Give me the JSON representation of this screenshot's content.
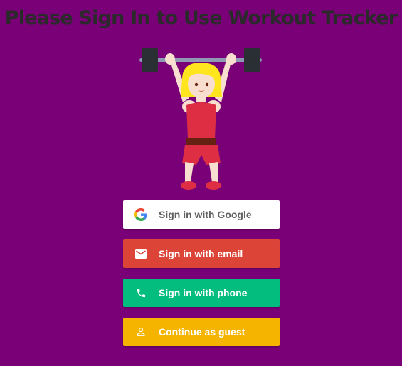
{
  "page": {
    "title": "Please Sign In to Use Workout Tracker",
    "background_color": "#7a0077",
    "hero_icon": "person-lifting-weights-icon"
  },
  "auth_buttons": [
    {
      "id": "google",
      "label": "Sign in with Google",
      "icon": "google-logo-icon",
      "background": "#ffffff",
      "text_color": "#616161"
    },
    {
      "id": "email",
      "label": "Sign in with email",
      "icon": "mail-icon",
      "background": "#db4437",
      "text_color": "#ffffff"
    },
    {
      "id": "phone",
      "label": "Sign in with phone",
      "icon": "phone-icon",
      "background": "#02bd7e",
      "text_color": "#ffffff"
    },
    {
      "id": "guest",
      "label": "Continue as guest",
      "icon": "person-icon",
      "background": "#f4b400",
      "text_color": "#ffffff"
    }
  ]
}
